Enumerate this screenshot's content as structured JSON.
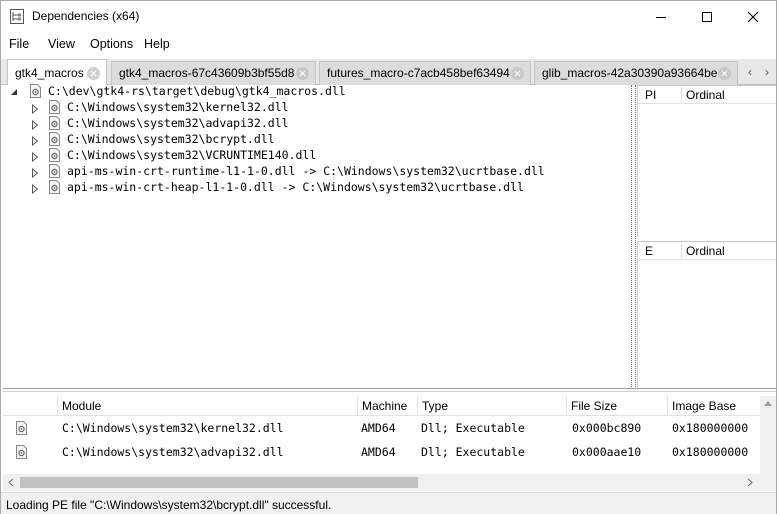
{
  "window": {
    "title": "Dependencies (x64)",
    "icons": {
      "app": "dependency-tree-icon",
      "minimize": "minimize-icon",
      "maximize": "maximize-icon",
      "close": "close-icon"
    }
  },
  "menu": {
    "file": "File",
    "view": "View",
    "options": "Options",
    "help": "Help"
  },
  "tabs": [
    {
      "label": "gtk4_macros",
      "active": true
    },
    {
      "label": "gtk4_macros-67c43609b3bf55d8",
      "active": false
    },
    {
      "label": "futures_macro-c7acb458bef63494",
      "active": false
    },
    {
      "label": "glib_macros-42a30390a93664be",
      "active": false
    }
  ],
  "tab_scroll": {
    "left": "‹",
    "right": "›"
  },
  "tree": {
    "root": "C:\\dev\\gtk4-rs\\target\\debug\\gtk4_macros.dll",
    "children": [
      "C:\\Windows\\system32\\kernel32.dll",
      "C:\\Windows\\system32\\advapi32.dll",
      "C:\\Windows\\system32\\bcrypt.dll",
      "C:\\Windows\\system32\\VCRUNTIME140.dll",
      "api-ms-win-crt-runtime-l1-1-0.dll -> C:\\Windows\\system32\\ucrtbase.dll",
      "api-ms-win-crt-heap-l1-1-0.dll -> C:\\Windows\\system32\\ucrtbase.dll"
    ]
  },
  "imports_pane": {
    "col1": "PI",
    "col2": "Ordinal"
  },
  "exports_pane": {
    "col1": "E",
    "col2": "Ordinal"
  },
  "modules": {
    "columns": [
      "Module",
      "Machine",
      "Type",
      "File Size",
      "Image Base"
    ],
    "rows": [
      [
        "C:\\Windows\\system32\\kernel32.dll",
        "AMD64",
        "Dll; Executable",
        "0x000bc890",
        "0x180000000"
      ],
      [
        "C:\\Windows\\system32\\advapi32.dll",
        "AMD64",
        "Dll; Executable",
        "0x000aae10",
        "0x180000000"
      ]
    ]
  },
  "status": "Loading PE file \"C:\\Windows\\system32\\bcrypt.dll\" successful.",
  "colors": {
    "tab_active": "#ffffff",
    "tab_inactive": "#dcdcdc",
    "status_bg": "#f0f0f0"
  }
}
